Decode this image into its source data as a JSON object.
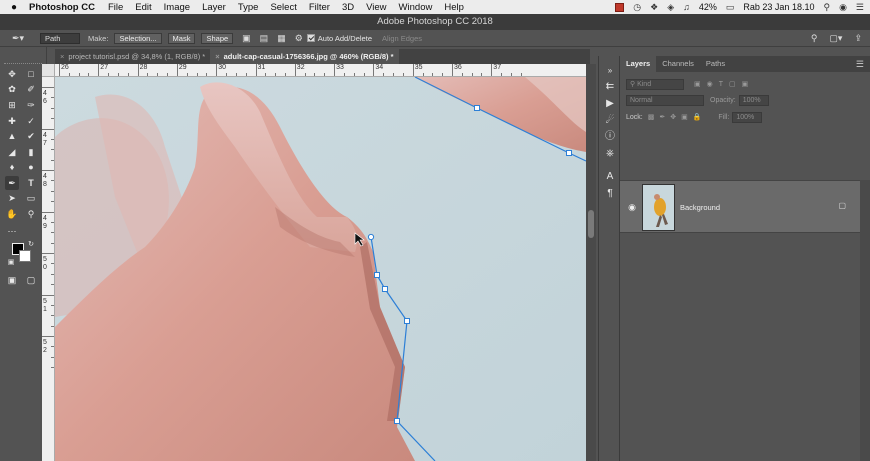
{
  "menubar": {
    "apple": "",
    "app_name": "Photoshop CC",
    "items": [
      "File",
      "Edit",
      "Image",
      "Layer",
      "Type",
      "Select",
      "Filter",
      "3D",
      "View",
      "Window",
      "Help"
    ],
    "battery": "42%",
    "datetime": "Rab 23 Jan  18.10"
  },
  "title": "Adobe Photoshop CC 2018",
  "options": {
    "mode": "Path",
    "make_label": "Make:",
    "selection_btn": "Selection...",
    "mask_btn": "Mask",
    "shape_btn": "Shape",
    "auto_add_delete": "Auto Add/Delete",
    "align_edges": "Align Edges"
  },
  "tabs": [
    {
      "label": "project tutorisl.psd @ 34,8% (1, RGB/8) *",
      "close": "×"
    },
    {
      "label": "adult-cap-casual-1756366.jpg @ 460% (RGB/8) *",
      "close": "×"
    }
  ],
  "ruler_top": [
    "26",
    "27",
    "28",
    "29",
    "30",
    "31",
    "32",
    "33",
    "34",
    "35",
    "36",
    "37"
  ],
  "ruler_left": [
    "4 6",
    "4 7",
    "4 8",
    "4 9",
    "5 0",
    "5 1",
    "5 2"
  ],
  "layers_panel": {
    "tabs": [
      "Layers",
      "Channels",
      "Paths"
    ],
    "filter_placeholder": "Kind",
    "blend_mode": "Normal",
    "opacity_label": "Opacity:",
    "opacity_value": "100%",
    "lock_label": "Lock:",
    "fill_label": "Fill:",
    "fill_value": "100%",
    "layer_name": "Background"
  },
  "colors": {
    "accent_path": "#2d7fd6",
    "fg_swatch": "#000000",
    "bg_swatch": "#ffffff"
  }
}
